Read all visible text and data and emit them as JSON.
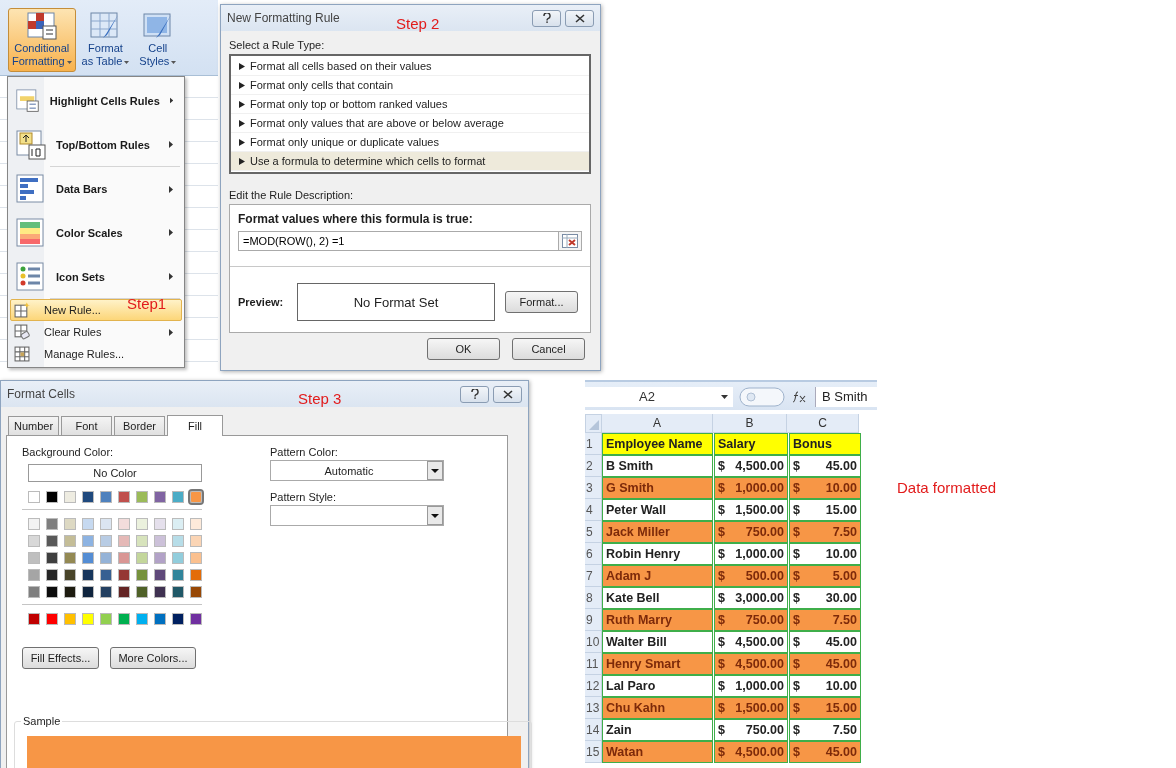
{
  "ribbon": {
    "buttons": [
      {
        "lines": [
          "Conditional",
          "Formatting"
        ],
        "selected": true
      },
      {
        "lines": [
          "Format",
          "as Table"
        ],
        "selected": false
      },
      {
        "lines": [
          "Cell",
          "Styles"
        ],
        "selected": false
      }
    ]
  },
  "menu": {
    "step_label": "Step1",
    "items": [
      {
        "kind": "large",
        "label": "Highlight Cells Rules",
        "submenu": true,
        "selected": false,
        "divider_after": false
      },
      {
        "kind": "large",
        "label": "Top/Bottom Rules",
        "submenu": true,
        "selected": false,
        "divider_after": true
      },
      {
        "kind": "large",
        "label": "Data Bars",
        "submenu": true,
        "selected": false,
        "divider_after": false
      },
      {
        "kind": "large",
        "label": "Color Scales",
        "submenu": true,
        "selected": false,
        "divider_after": false
      },
      {
        "kind": "large",
        "label": "Icon Sets",
        "submenu": true,
        "selected": false,
        "divider_after": true
      },
      {
        "kind": "small",
        "label": "New Rule...",
        "submenu": false,
        "selected": true,
        "divider_after": false
      },
      {
        "kind": "small",
        "label": "Clear Rules",
        "submenu": true,
        "selected": false,
        "divider_after": false
      },
      {
        "kind": "small",
        "label": "Manage Rules...",
        "submenu": false,
        "selected": false,
        "divider_after": false
      }
    ]
  },
  "rule_dialog": {
    "title": "New Formatting Rule",
    "step_label": "Step 2",
    "rule_type_label": "Select a Rule Type:",
    "rule_types": [
      {
        "label": "Format all cells based on their values",
        "selected": false
      },
      {
        "label": "Format only cells that contain",
        "selected": false
      },
      {
        "label": "Format only top or bottom ranked values",
        "selected": false
      },
      {
        "label": "Format only values that are above or below average",
        "selected": false
      },
      {
        "label": "Format only unique or duplicate values",
        "selected": false
      },
      {
        "label": "Use a formula to determine which cells to format",
        "selected": true
      }
    ],
    "description_label": "Edit the Rule Description:",
    "formula_label": "Format values where this formula is true:",
    "formula": "=MOD(ROW(), 2) =1",
    "preview_label": "Preview:",
    "preview_text": "No Format Set",
    "format_button": "Format...",
    "ok_button": "OK",
    "cancel_button": "Cancel"
  },
  "format_dialog": {
    "title": "Format Cells",
    "step_label": "Step 3",
    "tabs": [
      {
        "label": "Number",
        "selected": false
      },
      {
        "label": "Font",
        "selected": false
      },
      {
        "label": "Border",
        "selected": false
      },
      {
        "label": "Fill",
        "selected": true
      }
    ],
    "background_color_label": "Background Color:",
    "no_color": "No Color",
    "theme_colors": [
      {
        "color": "#ffffff",
        "selected": false
      },
      {
        "color": "#000000",
        "selected": false
      },
      {
        "color": "#eeece1",
        "selected": false
      },
      {
        "color": "#1f497d",
        "selected": false
      },
      {
        "color": "#4f81bd",
        "selected": false
      },
      {
        "color": "#c0504d",
        "selected": false
      },
      {
        "color": "#9bbb59",
        "selected": false
      },
      {
        "color": "#8064a2",
        "selected": false
      },
      {
        "color": "#4bacc6",
        "selected": false
      },
      {
        "color": "#f79646",
        "selected": true
      }
    ],
    "tint_rows": [
      [
        {
          "color": "#f2f2f2"
        },
        {
          "color": "#7f7f7f"
        },
        {
          "color": "#ddd9c3"
        },
        {
          "color": "#c6d9f0"
        },
        {
          "color": "#dbe5f1"
        },
        {
          "color": "#f2dcdb"
        },
        {
          "color": "#ebf1dd"
        },
        {
          "color": "#e5e0ec"
        },
        {
          "color": "#dbeef3"
        },
        {
          "color": "#fdeada"
        }
      ],
      [
        {
          "color": "#d8d8d8"
        },
        {
          "color": "#595959"
        },
        {
          "color": "#c4bd97"
        },
        {
          "color": "#8db3e2"
        },
        {
          "color": "#b8cce4"
        },
        {
          "color": "#e5b9b7"
        },
        {
          "color": "#d7e3bc"
        },
        {
          "color": "#ccc1d9"
        },
        {
          "color": "#b7dde8"
        },
        {
          "color": "#fbd5b5"
        }
      ],
      [
        {
          "color": "#bfbfbf"
        },
        {
          "color": "#3f3f3f"
        },
        {
          "color": "#938953"
        },
        {
          "color": "#548dd4"
        },
        {
          "color": "#95b3d7"
        },
        {
          "color": "#d99694"
        },
        {
          "color": "#c3d69b"
        },
        {
          "color": "#b2a2c7"
        },
        {
          "color": "#92cddc"
        },
        {
          "color": "#fac08f"
        }
      ],
      [
        {
          "color": "#a5a5a5"
        },
        {
          "color": "#262626"
        },
        {
          "color": "#494429"
        },
        {
          "color": "#17365d"
        },
        {
          "color": "#366092"
        },
        {
          "color": "#953734"
        },
        {
          "color": "#76923c"
        },
        {
          "color": "#5f497a"
        },
        {
          "color": "#31859b"
        },
        {
          "color": "#e36c09"
        }
      ],
      [
        {
          "color": "#7f7f7f"
        },
        {
          "color": "#0c0c0c"
        },
        {
          "color": "#1d1b10"
        },
        {
          "color": "#0f243e"
        },
        {
          "color": "#244061"
        },
        {
          "color": "#632423"
        },
        {
          "color": "#4f6128"
        },
        {
          "color": "#3f3151"
        },
        {
          "color": "#205867"
        },
        {
          "color": "#974806"
        }
      ]
    ],
    "standard_colors": [
      {
        "color": "#c00000"
      },
      {
        "color": "#ff0000"
      },
      {
        "color": "#ffc000"
      },
      {
        "color": "#ffff00"
      },
      {
        "color": "#92d050"
      },
      {
        "color": "#00b050"
      },
      {
        "color": "#00b0f0"
      },
      {
        "color": "#0070c0"
      },
      {
        "color": "#002060"
      },
      {
        "color": "#7030a0"
      }
    ],
    "fill_effects_button": "Fill Effects...",
    "more_colors_button": "More Colors...",
    "pattern_color_label": "Pattern Color:",
    "pattern_color": "Automatic",
    "pattern_style_label": "Pattern Style:",
    "sample_label": "Sample",
    "sample": {
      "color": "#f79646"
    }
  },
  "spreadsheet": {
    "name_box": "A2",
    "formula": "B Smith",
    "columns": [
      "A",
      "B",
      "C"
    ],
    "note": "Data formatted",
    "rows": [
      {
        "number": "1",
        "kind": "header",
        "cells": [
          "Employee Name",
          "Salary",
          "Bonus"
        ]
      },
      {
        "number": "2",
        "kind": "plain",
        "name": "B Smith",
        "salary": "4,500.00",
        "bonus": "45.00",
        "currency": "$"
      },
      {
        "number": "3",
        "kind": "formatted",
        "name": "G Smith",
        "salary": "1,000.00",
        "bonus": "10.00",
        "currency": "$"
      },
      {
        "number": "4",
        "kind": "plain",
        "name": "Peter Wall",
        "salary": "1,500.00",
        "bonus": "15.00",
        "currency": "$"
      },
      {
        "number": "5",
        "kind": "formatted",
        "name": "Jack Miller",
        "salary": "750.00",
        "bonus": "7.50",
        "currency": "$"
      },
      {
        "number": "6",
        "kind": "plain",
        "name": "Robin Henry",
        "salary": "1,000.00",
        "bonus": "10.00",
        "currency": "$"
      },
      {
        "number": "7",
        "kind": "formatted",
        "name": "Adam J",
        "salary": "500.00",
        "bonus": "5.00",
        "currency": "$"
      },
      {
        "number": "8",
        "kind": "plain",
        "name": "Kate Bell",
        "salary": "3,000.00",
        "bonus": "30.00",
        "currency": "$"
      },
      {
        "number": "9",
        "kind": "formatted",
        "name": "Ruth Marry",
        "salary": "750.00",
        "bonus": "7.50",
        "currency": "$"
      },
      {
        "number": "10",
        "kind": "plain",
        "name": "Walter Bill",
        "salary": "4,500.00",
        "bonus": "45.00",
        "currency": "$"
      },
      {
        "number": "11",
        "kind": "formatted",
        "name": "Henry Smart",
        "salary": "4,500.00",
        "bonus": "45.00",
        "currency": "$"
      },
      {
        "number": "12",
        "kind": "plain",
        "name": "Lal Paro",
        "salary": "1,000.00",
        "bonus": "10.00",
        "currency": "$"
      },
      {
        "number": "13",
        "kind": "formatted",
        "name": "Chu Kahn",
        "salary": "1,500.00",
        "bonus": "15.00",
        "currency": "$"
      },
      {
        "number": "14",
        "kind": "plain",
        "name": "Zain",
        "salary": "750.00",
        "bonus": "7.50",
        "currency": "$"
      },
      {
        "number": "15",
        "kind": "formatted",
        "name": "Watan",
        "salary": "4,500.00",
        "bonus": "45.00",
        "currency": "$"
      }
    ]
  }
}
